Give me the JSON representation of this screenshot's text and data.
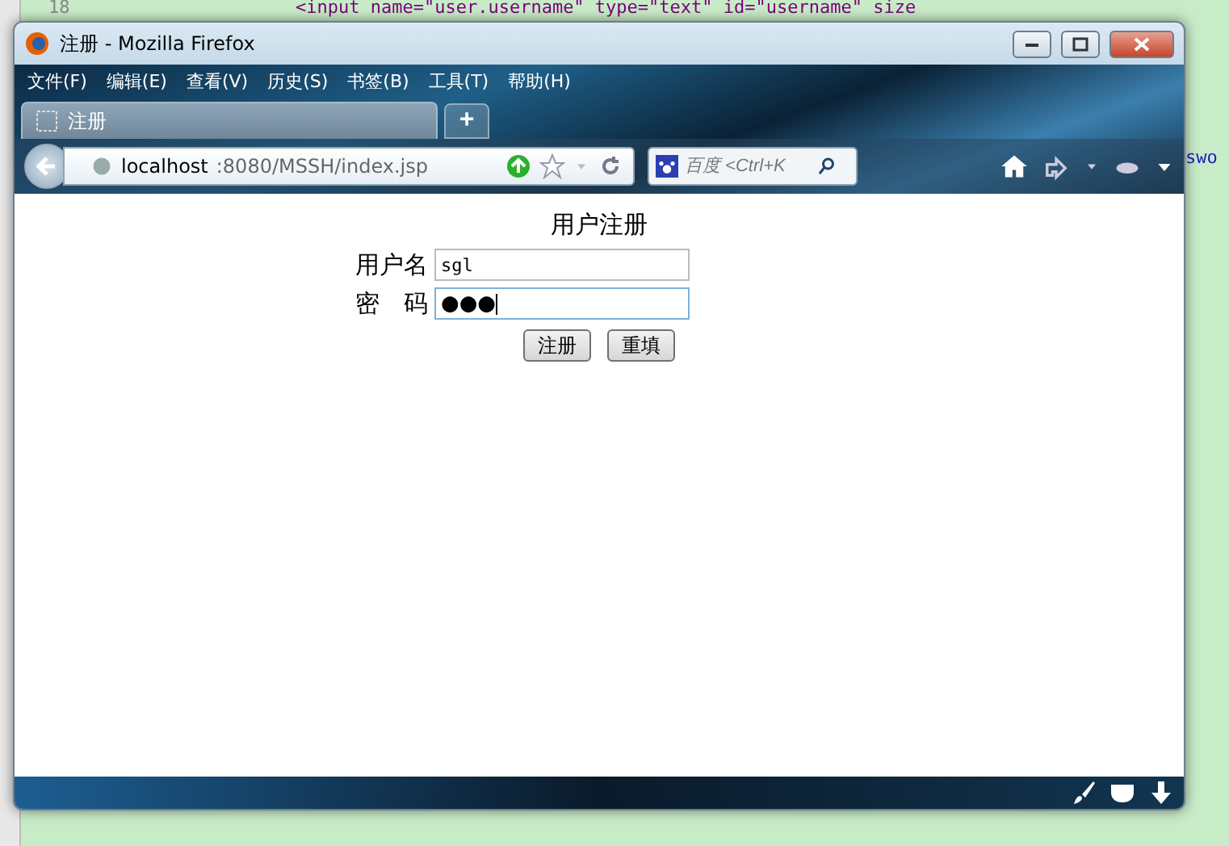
{
  "editor": {
    "line_number": "18",
    "code_top": "<input name=\"user.username\" type=\"text\" id=\"username\" size",
    "code_right": "swo"
  },
  "window": {
    "title": "注册 - Mozilla Firefox"
  },
  "menu": [
    "文件(F)",
    "编辑(E)",
    "查看(V)",
    "历史(S)",
    "书签(B)",
    "工具(T)",
    "帮助(H)"
  ],
  "tabs": [
    {
      "label": "注册",
      "selected": true
    }
  ],
  "new_tab": "+",
  "address": {
    "host": "localhost",
    "rest": ":8080/MSSH/index.jsp"
  },
  "search": {
    "placeholder": "百度 <Ctrl+K"
  },
  "form": {
    "heading": "用户注册",
    "fields": [
      {
        "label": "用户名",
        "value": "sgl",
        "kind": "text"
      },
      {
        "label": "密　码",
        "value": "●●●",
        "kind": "password"
      }
    ],
    "buttons": [
      "注册",
      "重填"
    ]
  }
}
